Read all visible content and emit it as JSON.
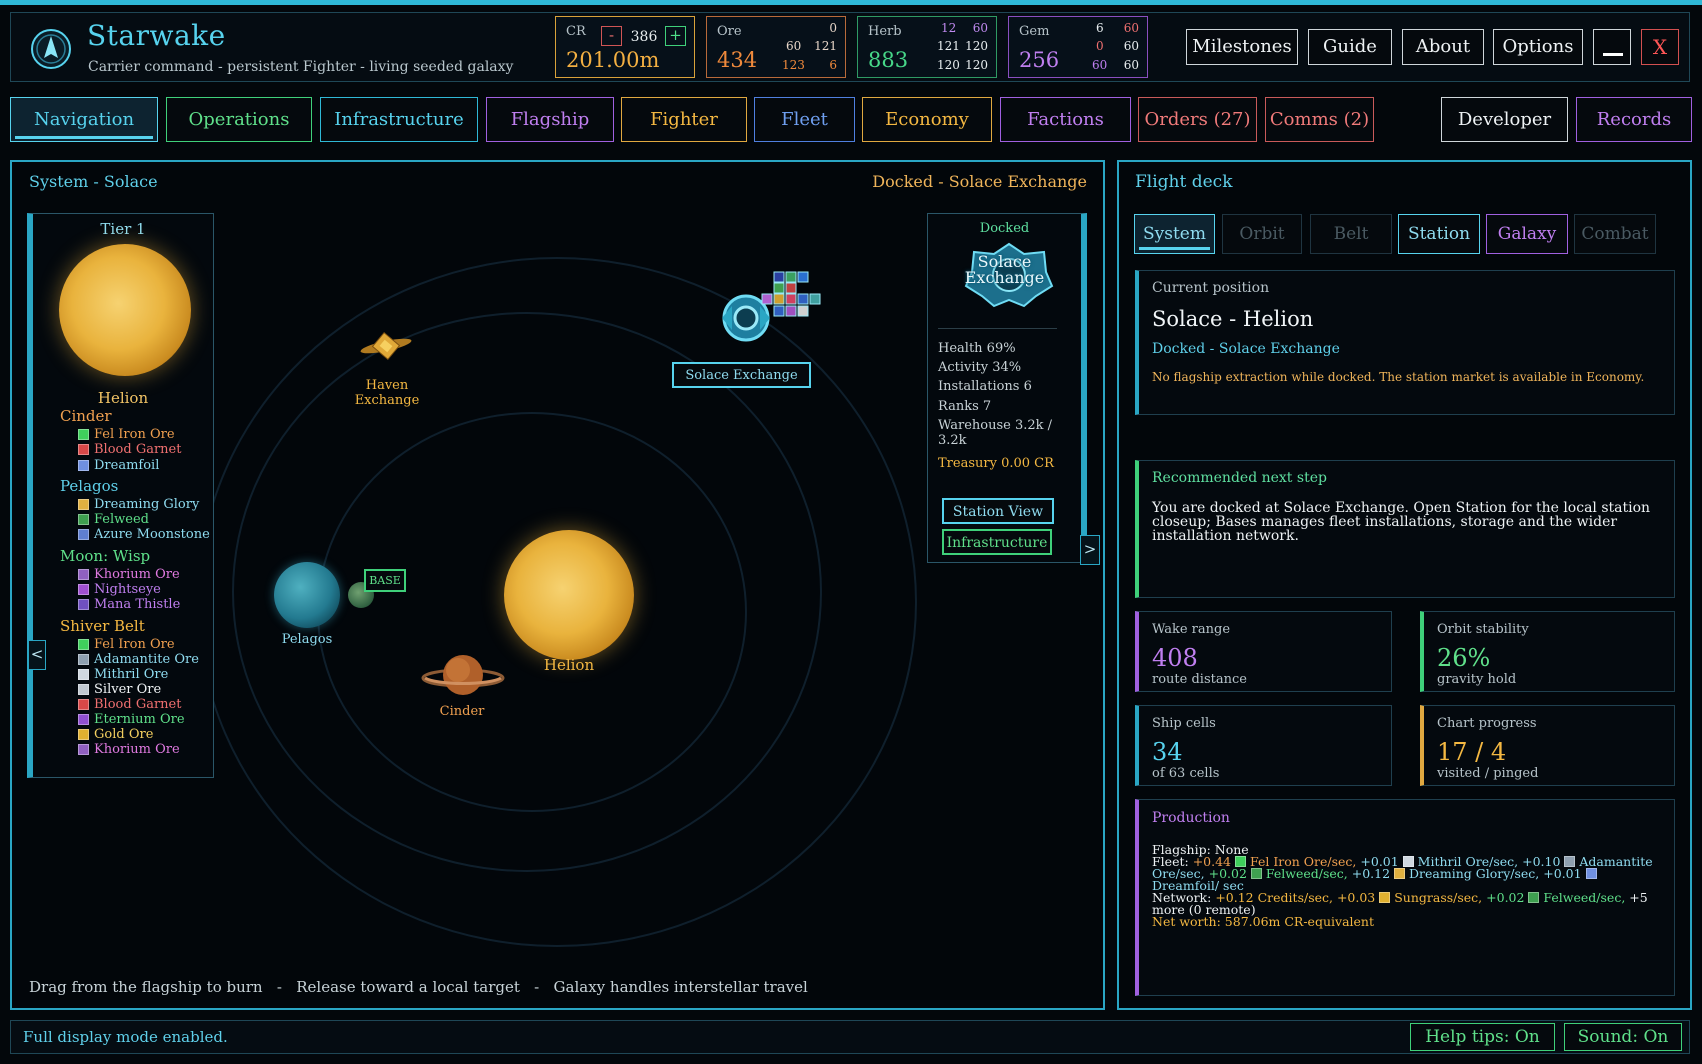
{
  "app": {
    "title": "Starwake",
    "subtitle": "Carrier command - persistent Fighter - living seeded galaxy"
  },
  "resources": {
    "cr": {
      "label": "CR",
      "minus": "-",
      "plus": "+",
      "step": "386",
      "value": "201.00m"
    },
    "ore": {
      "label": "Ore",
      "value": "434",
      "r1a": "0",
      "r2a": "60",
      "r2b": "121",
      "r3a": "123",
      "r3b": "6"
    },
    "herb": {
      "label": "Herb",
      "value": "883",
      "r1a": "12",
      "r1b": "60",
      "r2a": "121",
      "r2b": "120",
      "r3a": "120",
      "r3b": "120"
    },
    "gem": {
      "label": "Gem",
      "value": "256",
      "r1a": "6",
      "r1b": "60",
      "r2a": "0",
      "r2b": "60",
      "r3a": "60",
      "r3b": "60"
    }
  },
  "header_buttons": {
    "milestones": "Milestones",
    "guide": "Guide",
    "about": "About",
    "options": "Options",
    "close": "X"
  },
  "tabs": {
    "navigation": "Navigation",
    "operations": "Operations",
    "infrastructure": "Infrastructure",
    "flagship": "Flagship",
    "fighter": "Fighter",
    "fleet": "Fleet",
    "economy": "Economy",
    "factions": "Factions",
    "orders": "Orders (27)",
    "comms": "Comms (2)",
    "developer": "Developer",
    "records": "Records"
  },
  "map": {
    "system_title": "System - Solace",
    "docked_title": "Docked - Solace Exchange",
    "labels": {
      "haven": "Haven Exchange",
      "solace": "Solace Exchange",
      "base": "BASE",
      "pelagos": "Pelagos",
      "helion": "Helion",
      "cinder": "Cinder"
    },
    "hint": "Drag from the flagship to burn   -   Release toward a local target   -   Galaxy handles interstellar travel",
    "collapse_left": "<",
    "expand_right": ">"
  },
  "system_list": {
    "tier": "Tier 1",
    "star": "Helion",
    "groups": [
      {
        "name": "Cinder",
        "items": [
          "Fel Iron Ore",
          "Blood Garnet",
          "Dreamfoil"
        ]
      },
      {
        "name": "Pelagos",
        "items": [
          "Dreaming Glory",
          "Felweed",
          "Azure Moonstone"
        ]
      },
      {
        "name": "Moon: Wisp",
        "items": [
          "Khorium Ore",
          "Nightseye",
          "Mana Thistle"
        ]
      },
      {
        "name": "Shiver Belt",
        "items": [
          "Fel Iron Ore",
          "Adamantite Ore",
          "Mithril Ore",
          "Silver Ore",
          "Blood Garnet",
          "Eternium Ore",
          "Gold Ore",
          "Khorium Ore"
        ]
      }
    ]
  },
  "station_card": {
    "status": "Docked",
    "name": "Solace Exchange",
    "health": "Health  69%",
    "activity": "Activity  34%",
    "installations": "Installations  6",
    "ranks": "Ranks  7",
    "warehouse": "Warehouse  3.2k / 3.2k",
    "treasury": "Treasury  0.00 CR",
    "station_view": "Station View",
    "infrastructure": "Infrastructure"
  },
  "flight_deck": {
    "title": "Flight deck",
    "tabs": {
      "system": "System",
      "orbit": "Orbit",
      "belt": "Belt",
      "station": "Station",
      "galaxy": "Galaxy",
      "combat": "Combat"
    },
    "current_position": {
      "title": "Current position",
      "location": "Solace - Helion",
      "docked": "Docked - Solace Exchange",
      "note": "No flagship extraction while docked. The station market is available in Economy."
    },
    "recommended": {
      "title": "Recommended next step",
      "body": "You are docked at Solace Exchange. Open Station for the local station closeup; Bases manages fleet installations, storage and the wider installation network."
    },
    "stats": {
      "wake": {
        "title": "Wake range",
        "value": "408",
        "sub": "route distance"
      },
      "orbit": {
        "title": "Orbit stability",
        "value": "26%",
        "sub": "gravity hold"
      },
      "cells": {
        "title": "Ship cells",
        "value": "34",
        "sub": "of 63 cells"
      },
      "chart": {
        "title": "Chart progress",
        "value": "17 / 4",
        "sub": "visited / pinged"
      }
    },
    "production": {
      "title": "Production",
      "flagship": "Flagship: None",
      "fleet_prefix": "Fleet: ",
      "fleet_1": "+0.44",
      "fleet_1_name": "Fel Iron Ore/sec, ",
      "fleet_2": "+0.01",
      "fleet_2_name": "Mithril Ore/sec, ",
      "fleet_3": "+0.10",
      "fleet_3_name": "Adamantite Ore/sec, ",
      "fleet_4": "+0.02",
      "fleet_4_name": "Felweed/sec, ",
      "fleet_5": "+0.12",
      "fleet_5_name": "Dreaming Glory/sec, ",
      "fleet_6": "+0.01",
      "fleet_6_name": "Dreamfoil/ sec",
      "network_prefix": "Network: ",
      "net_1": "+0.12 Credits/sec, ",
      "net_2": "+0.03",
      "net_2_name": "Sungrass/sec, ",
      "net_3": "+0.02",
      "net_3_name": "Felweed/sec, ",
      "net_more": "+5 more  (0 remote)",
      "net_worth": "Net worth: 587.06m CR-equivalent"
    }
  },
  "footer": {
    "message": "Full display mode enabled.",
    "help_tips": "Help tips: On",
    "sound": "Sound: On"
  }
}
